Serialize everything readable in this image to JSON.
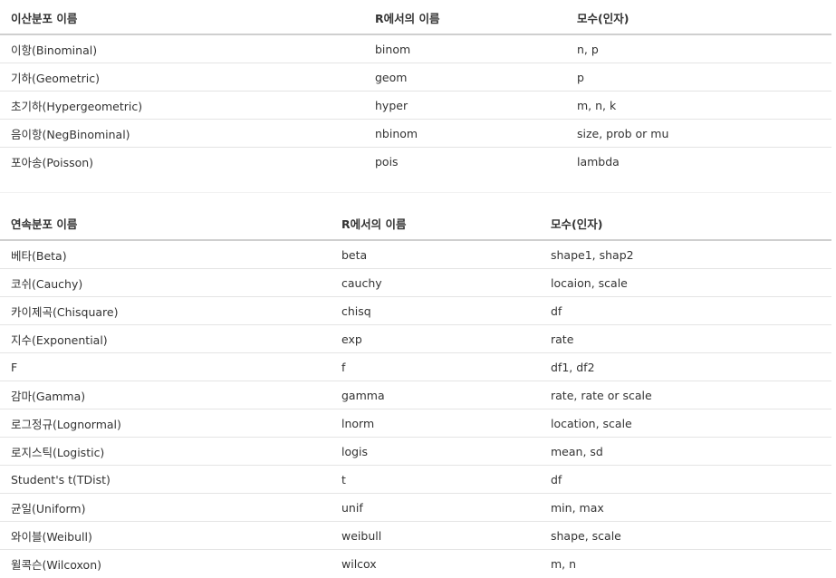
{
  "discrete": {
    "headers": [
      "이산분포 이름",
      "R에서의 이름",
      "모수(인자)"
    ],
    "rows": [
      [
        "이항(Binominal)",
        "binom",
        "n, p"
      ],
      [
        "기하(Geometric)",
        "geom",
        "p"
      ],
      [
        "초기하(Hypergeometric)",
        "hyper",
        "m, n, k"
      ],
      [
        "음이항(NegBinominal)",
        "nbinom",
        "size, prob or mu"
      ],
      [
        "포아송(Poisson)",
        "pois",
        "lambda"
      ]
    ]
  },
  "continuous": {
    "headers": [
      "연속분포 이름",
      "R에서의 이름",
      "모수(인자)"
    ],
    "rows": [
      [
        "베타(Beta)",
        "beta",
        "shape1, shap2"
      ],
      [
        "코쉬(Cauchy)",
        "cauchy",
        "locaion, scale"
      ],
      [
        "카이제곡(Chisquare)",
        "chisq",
        "df"
      ],
      [
        "지수(Exponential)",
        "exp",
        "rate"
      ],
      [
        "F",
        "f",
        "df1, df2"
      ],
      [
        "감마(Gamma)",
        "gamma",
        "rate, rate or scale"
      ],
      [
        "로그정규(Lognormal)",
        "lnorm",
        "location, scale"
      ],
      [
        "로지스틱(Logistic)",
        "logis",
        "mean, sd"
      ],
      [
        "Student's t(TDist)",
        "t",
        "df"
      ],
      [
        "균일(Uniform)",
        "unif",
        "min, max"
      ],
      [
        "와이블(Weibull)",
        "weibull",
        "shape, scale"
      ],
      [
        "윌콕슨(Wilcoxon)",
        "wilcox",
        "m, n"
      ]
    ]
  }
}
